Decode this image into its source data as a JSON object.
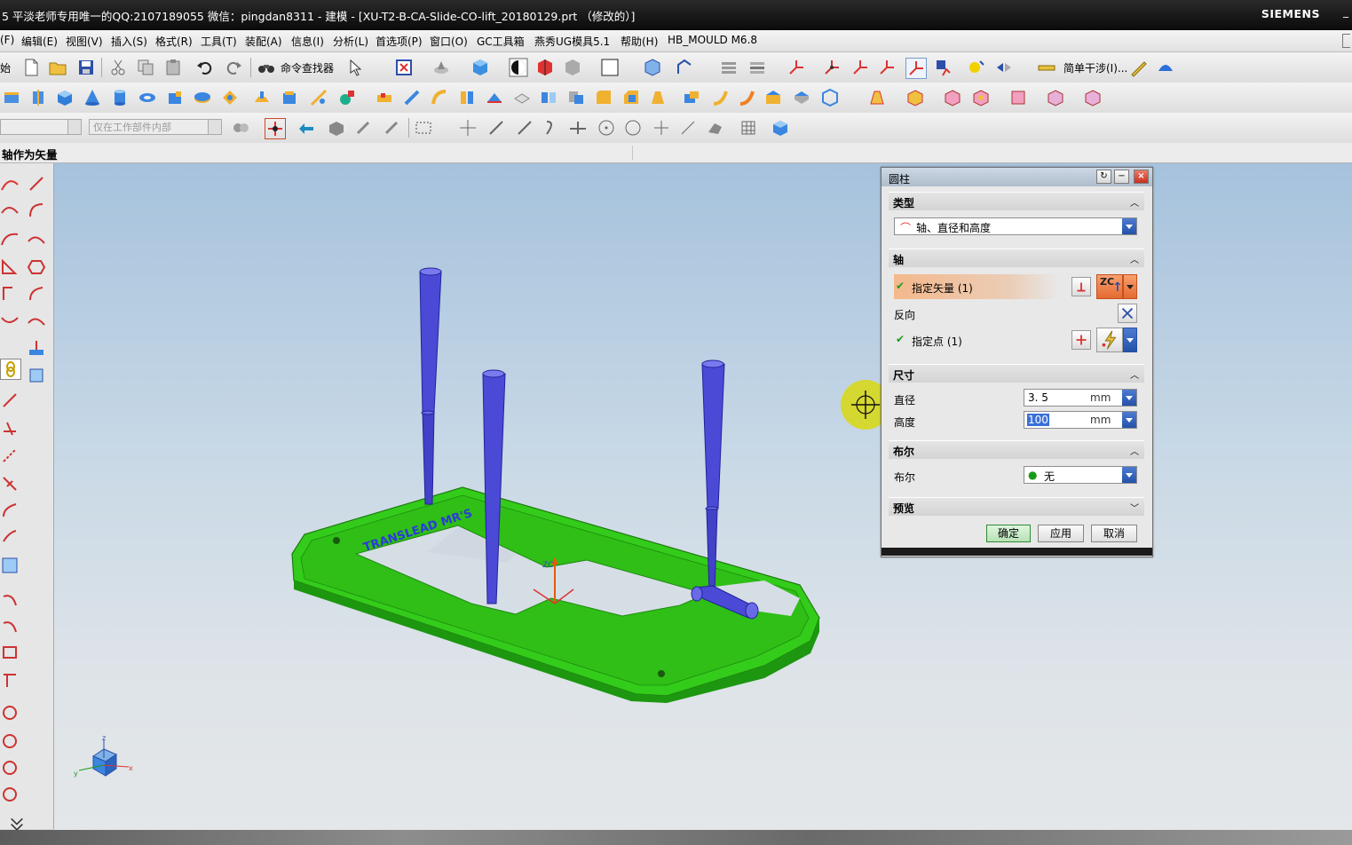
{
  "window": {
    "title": "5 平淡老师专用唯一的QQ:2107189055  微信：pingdan8311 - 建模 - [XU-T2-B-CA-Slide-CO-lift_20180129.prt （修改的）]",
    "brand": "SIEMENS"
  },
  "menu": [
    "(F)",
    "编辑(E)",
    "视图(V)",
    "插入(S)",
    "格式(R)",
    "工具(T)",
    "装配(A)",
    "信息(I)",
    "分析(L)",
    "首选项(P)",
    "窗口(O)",
    "GC工具箱",
    "燕秀UG模具5.1",
    "帮助(H)",
    "HB_MOULD M6.8"
  ],
  "toolbar": {
    "start_label": "始",
    "command_finder": "命令查找器",
    "simple_interference": "简单干涉(I)...",
    "filter_placeholder": "仅在工作部件内部"
  },
  "cue": "轴作为矢量",
  "dialog": {
    "title": "圆柱",
    "type_section": "类型",
    "type_value": "轴、直径和高度",
    "axis_section": "轴",
    "specify_vector": "指定矢量 (1)",
    "reverse": "反向",
    "specify_point": "指定点 (1)",
    "vector_icon_text": "ZC",
    "dims_section": "尺寸",
    "diameter_label": "直径",
    "diameter_value": "3. 5",
    "diameter_unit": "mm",
    "height_label": "高度",
    "height_value": "100",
    "height_unit": "mm",
    "bool_section": "布尔",
    "bool_label": "布尔",
    "bool_value": "无",
    "preview_section": "预览",
    "ok": "确定",
    "apply": "应用",
    "cancel": "取消"
  },
  "viewport": {
    "model_text": "TRANSLEAD MR'S",
    "zc_label": "ZC",
    "triad_z": "z",
    "triad_x": "x",
    "triad_y": "y"
  },
  "colors": {
    "model_green": "#33cc1a",
    "pin_blue": "#4a4ad6",
    "highlight_orange": "#f4b88c",
    "close_red": "#d9402b"
  }
}
